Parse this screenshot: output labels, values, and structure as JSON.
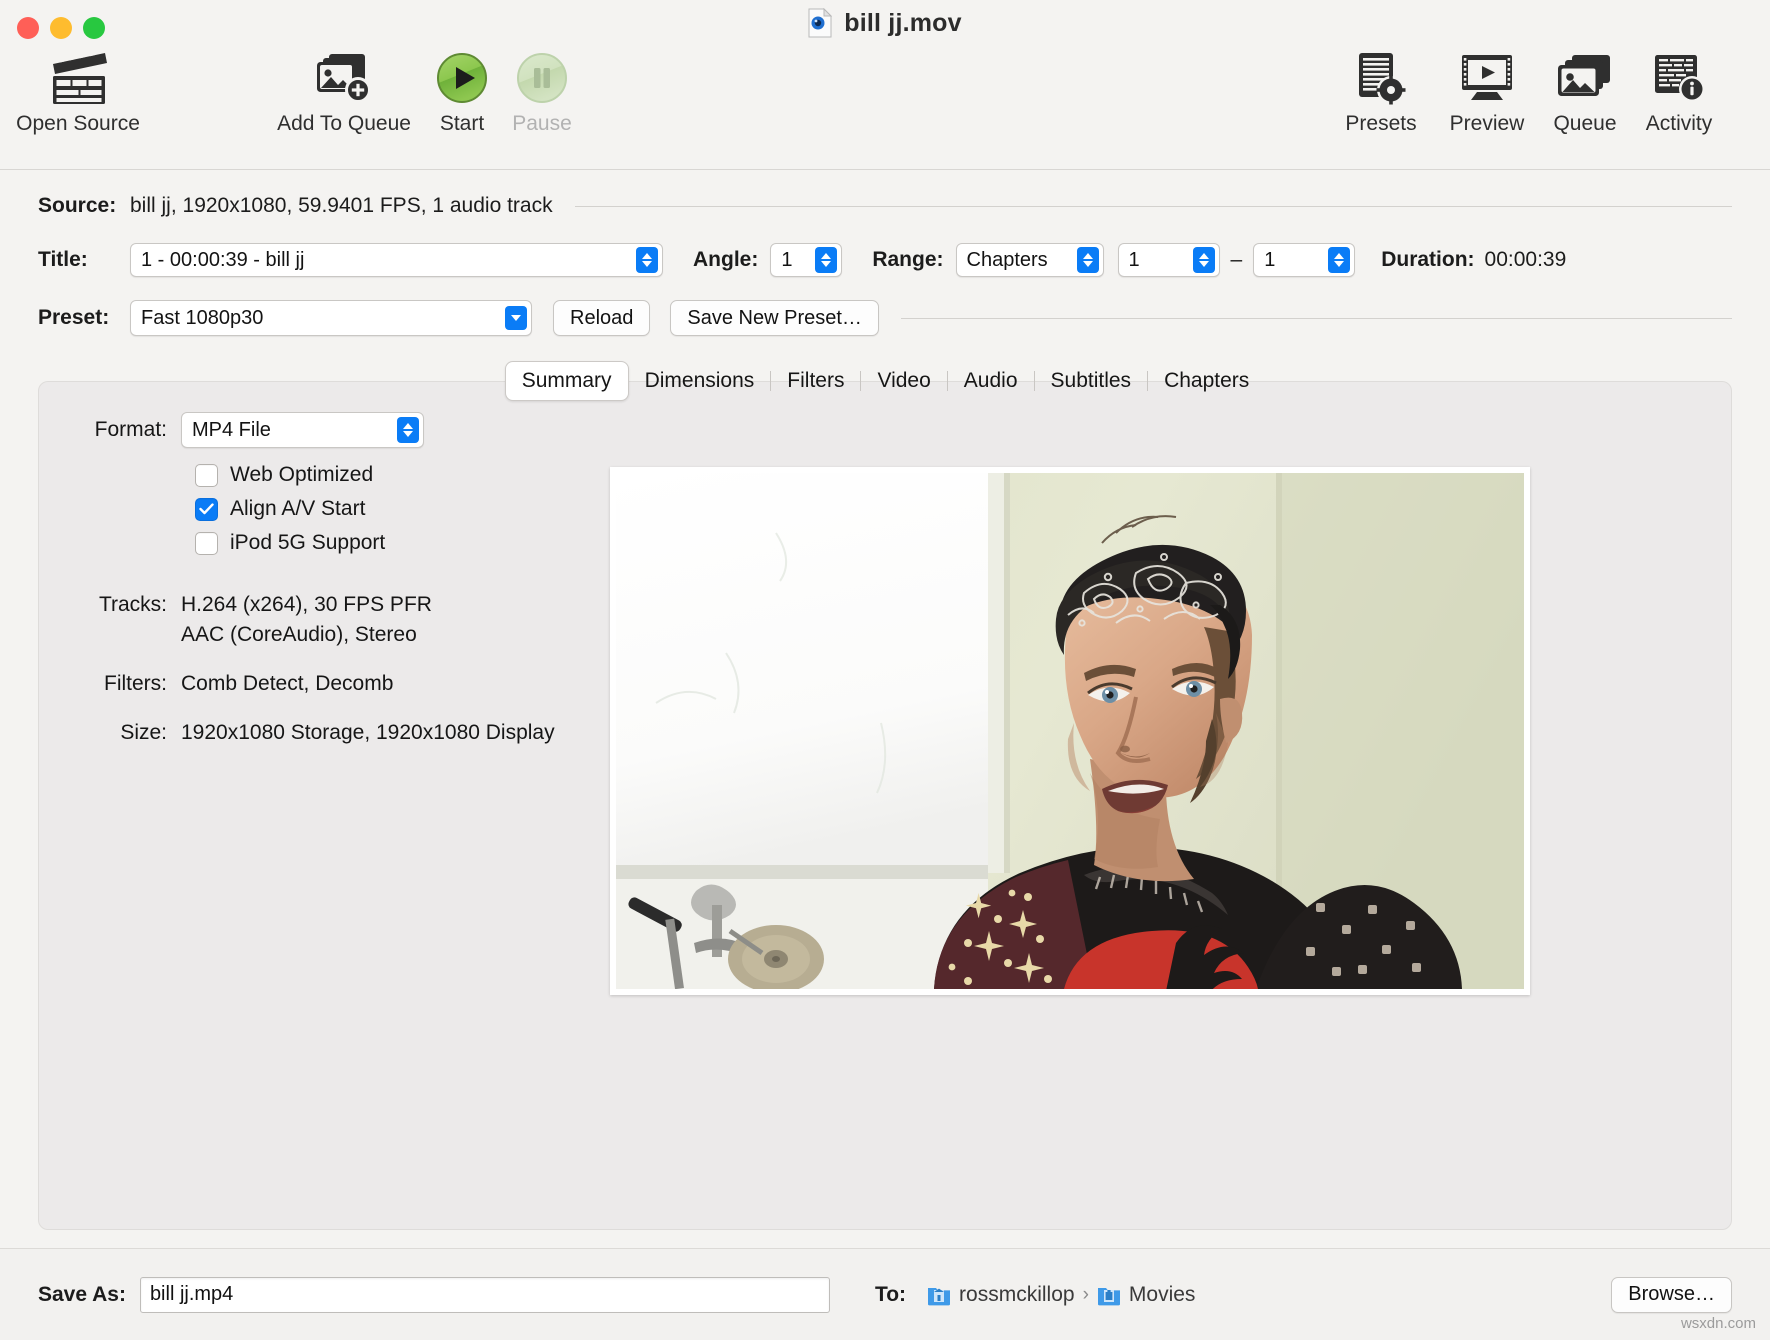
{
  "window": {
    "title": "bill jj.mov",
    "traffic_lights": [
      "close",
      "minimize",
      "zoom"
    ],
    "watermark": "wsxdn.com"
  },
  "toolbar": {
    "items": [
      {
        "label": "Open Source",
        "icon": "clapperboard-icon",
        "enabled": true
      },
      {
        "label": "Add To Queue",
        "icon": "add-image-icon",
        "enabled": true
      },
      {
        "label": "Start",
        "icon": "play-circle-icon",
        "enabled": true
      },
      {
        "label": "Pause",
        "icon": "pause-circle-icon",
        "enabled": false
      },
      {
        "label": "Presets",
        "icon": "presets-gear-icon",
        "enabled": true
      },
      {
        "label": "Preview",
        "icon": "monitor-play-icon",
        "enabled": true
      },
      {
        "label": "Queue",
        "icon": "queue-stack-icon",
        "enabled": true
      },
      {
        "label": "Activity",
        "icon": "activity-info-icon",
        "enabled": true
      }
    ]
  },
  "source": {
    "label": "Source:",
    "value": "bill jj, 1920x1080, 59.9401 FPS, 1 audio track"
  },
  "title_row": {
    "title_label": "Title:",
    "title_value": "1 - 00:00:39 - bill jj",
    "angle_label": "Angle:",
    "angle_value": "1",
    "range_label": "Range:",
    "range_value": "Chapters",
    "range_start": "1",
    "range_dash": "–",
    "range_end": "1",
    "duration_label": "Duration:",
    "duration_value": "00:00:39"
  },
  "preset_row": {
    "preset_label": "Preset:",
    "preset_value": "Fast 1080p30",
    "reload_label": "Reload",
    "save_new_preset_label": "Save New Preset…"
  },
  "tabs": [
    {
      "label": "Summary",
      "active": true
    },
    {
      "label": "Dimensions",
      "active": false
    },
    {
      "label": "Filters",
      "active": false
    },
    {
      "label": "Video",
      "active": false
    },
    {
      "label": "Audio",
      "active": false
    },
    {
      "label": "Subtitles",
      "active": false
    },
    {
      "label": "Chapters",
      "active": false
    }
  ],
  "summary": {
    "format_label": "Format:",
    "format_value": "MP4 File",
    "checkboxes": [
      {
        "label": "Web Optimized",
        "checked": false
      },
      {
        "label": "Align A/V Start",
        "checked": true
      },
      {
        "label": "iPod 5G Support",
        "checked": false
      }
    ],
    "tracks_label": "Tracks:",
    "tracks_line1": "H.264 (x264), 30 FPS PFR",
    "tracks_line2": "AAC (CoreAudio), Stereo",
    "filters_label": "Filters:",
    "filters_value": "Comb Detect, Decomb",
    "size_label": "Size:",
    "size_value": "1920x1080 Storage, 1920x1080 Display"
  },
  "footer": {
    "save_as_label": "Save As:",
    "save_as_value": "bill jj.mp4",
    "to_label": "To:",
    "path": [
      {
        "name": "rossmckillop",
        "icon": "home-folder-icon"
      },
      {
        "name": "Movies",
        "icon": "movies-folder-icon"
      }
    ],
    "path_separator": "›",
    "browse_label": "Browse…"
  },
  "colors": {
    "accent_blue": "#0a7cf6",
    "start_green": "#7dc242",
    "window_bg": "#f4f3f1",
    "panel_bg": "#eceaea"
  }
}
